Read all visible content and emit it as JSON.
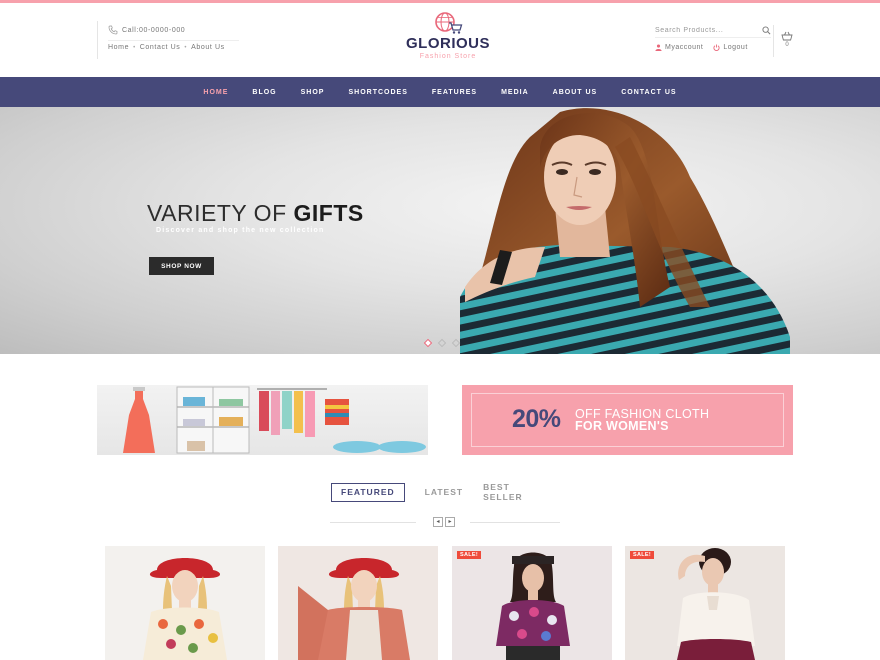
{
  "header": {
    "call_text": "Call:00-0000-000",
    "links": [
      "Home",
      "Contact Us",
      "About Us"
    ],
    "link_separator": "•",
    "logo_title": "GLORIOUS",
    "logo_subtitle": "Fashion Store",
    "search_placeholder": "Search Products...",
    "account_label": "Myaccount",
    "logout_label": "Logout",
    "cart_count": "0"
  },
  "nav": {
    "items": [
      "HOME",
      "BLOG",
      "SHOP",
      "SHORTCODES",
      "FEATURES",
      "MEDIA",
      "ABOUT US",
      "CONTACT US"
    ],
    "active_index": 0
  },
  "hero": {
    "title_light": "VARIETY OF ",
    "title_bold": "GIFTS",
    "subtitle": "Discover and shop the new collection",
    "button_label": "SHOP NOW",
    "slides": 3,
    "active_slide": 0
  },
  "promo": {
    "percent": "20%",
    "line1": "OFF FASHION CLOTH",
    "line2": "FOR WOMEN'S"
  },
  "product_tabs": {
    "items": [
      "FEATURED",
      "LATEST",
      "BEST SELLER"
    ],
    "active_index": 0,
    "prev_label": "◂",
    "next_label": "▸"
  },
  "products": [
    {
      "badge": ""
    },
    {
      "badge": ""
    },
    {
      "badge": "SALE!"
    },
    {
      "badge": "SALE!"
    }
  ],
  "colors": {
    "accent_pink": "#f7a1ac",
    "nav_navy": "#46497a",
    "sale_red": "#ef4b3b"
  }
}
